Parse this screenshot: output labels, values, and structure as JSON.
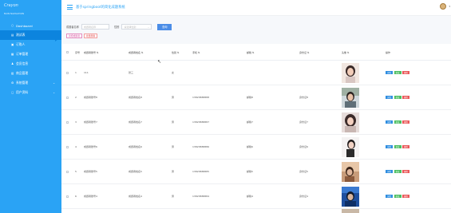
{
  "sidebar": {
    "logo": "Crayon",
    "caption": "MAIN NAVIGATION",
    "items": [
      {
        "label": "Dashboard",
        "icon": "circle-icon"
      },
      {
        "label": "测试表",
        "icon": "list-icon"
      },
      {
        "label": "订购人",
        "icon": "user-icon"
      },
      {
        "label": "订单管理",
        "icon": "order-icon"
      },
      {
        "label": "会员信息",
        "icon": "member-icon"
      },
      {
        "label": "商品管理",
        "icon": "goods-icon"
      },
      {
        "label": "系统管理",
        "icon": "settings-icon"
      },
      {
        "label": "用户资料",
        "icon": "profile-icon"
      }
    ]
  },
  "header": {
    "title": "基于springboot的简化成题系统"
  },
  "search": {
    "label1": "成题者名称",
    "placeholder1": "成题者名称",
    "label2": "性别",
    "placeholder2": "请选择性别",
    "button": "查询"
  },
  "actions": {
    "add": "新增成题者",
    "delete": "批量删除"
  },
  "table": {
    "headers": [
      "序号",
      "成题者账号",
      "成题者姓名",
      "性别",
      "手机",
      "邮箱",
      "身份证",
      "头像",
      "操作"
    ],
    "rows": [
      {
        "no": "1",
        "account": "111",
        "name": "张三",
        "gender": "女",
        "phone": "",
        "email": "",
        "idcard": ""
      },
      {
        "no": "2",
        "account": "成题者账号8",
        "name": "成题者姓名8",
        "gender": "男",
        "phone": "13823888888",
        "email": "邮箱8",
        "idcard": "身份证8"
      },
      {
        "no": "3",
        "account": "成题者账号7",
        "name": "成题者姓名7",
        "gender": "男",
        "phone": "13823888887",
        "email": "邮箱7",
        "idcard": "身份证7"
      },
      {
        "no": "4",
        "account": "成题者账号6",
        "name": "成题者姓名6",
        "gender": "男",
        "phone": "13823888886",
        "email": "邮箱6",
        "idcard": "身份证6"
      },
      {
        "no": "5",
        "account": "成题者账号5",
        "name": "成题者姓名5",
        "gender": "男",
        "phone": "13823888885",
        "email": "邮箱5",
        "idcard": "身份证5"
      },
      {
        "no": "6",
        "account": "成题者账号4",
        "name": "成题者姓名4",
        "gender": "男",
        "phone": "13823888884",
        "email": "邮箱4",
        "idcard": "身份证4"
      }
    ],
    "ops": {
      "detail": "详情",
      "edit": "修改",
      "remove": "删除"
    }
  },
  "colors": {
    "sidebar": "#2aa3f5",
    "active": "#0c84de",
    "detail": "#2e8de0",
    "edit": "#4cbe62",
    "remove": "#e9595a"
  }
}
